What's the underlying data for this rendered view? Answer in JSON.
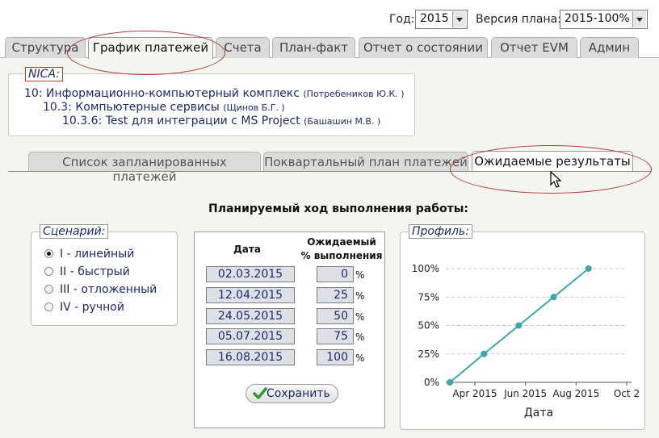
{
  "topbar": {
    "year_label": "Год:",
    "year_value": "2015",
    "version_label": "Версия плана:",
    "version_value": "2015-100%"
  },
  "main_tabs": [
    "Структура",
    "График платежей",
    "Счета",
    "План-факт",
    "Отчет о состоянии",
    "Отчет EVM",
    "Админ"
  ],
  "nica": {
    "label": "NICA:",
    "items": [
      {
        "text": "10: Информационно-компьютерный комплекс",
        "who": "(Потребеников Ю.К. )"
      },
      {
        "text": "10.3: Компьютерные сервисы",
        "who": "(Щинов Б.Г. )"
      },
      {
        "text": "10.3.6: Test для интеграции с MS Project",
        "who": "(Башашин М.В. )"
      }
    ]
  },
  "sub_tabs": [
    "Список запланированных платежей",
    "Поквартальный план платежей",
    "Ожидаемые результаты"
  ],
  "heading": "Планируемый ход выполнения работы:",
  "scenario": {
    "legend": "Сценарий:",
    "options": [
      "I - линейный",
      "II - быстрый",
      "III - отложенный",
      "IV - ручной"
    ],
    "selected": 0
  },
  "table": {
    "col_date": "Дата",
    "col_pct_line1": "Ожидаемый",
    "col_pct_line2": "% выполнения",
    "pct_sign": "%",
    "rows": [
      {
        "date": "02.03.2015",
        "pct": "0"
      },
      {
        "date": "12.04.2015",
        "pct": "25"
      },
      {
        "date": "24.05.2015",
        "pct": "50"
      },
      {
        "date": "05.07.2015",
        "pct": "75"
      },
      {
        "date": "16.08.2015",
        "pct": "100"
      }
    ],
    "save_label": "Сохранить"
  },
  "profile_legend": "Профиль:",
  "chart_data": {
    "type": "line",
    "title": "",
    "xlabel": "Дата",
    "ylabel": "",
    "x_ticks": [
      "Apr 2015",
      "Jun 2015",
      "Aug 2015",
      "Oct 2"
    ],
    "y_ticks": [
      "0%",
      "25%",
      "50%",
      "75%",
      "100%"
    ],
    "ylim": [
      0,
      100
    ],
    "series": [
      {
        "x": [
          "2015-03-02",
          "2015-04-12",
          "2015-05-24",
          "2015-07-05",
          "2015-08-16"
        ],
        "values": [
          0,
          25,
          50,
          75,
          100
        ]
      }
    ],
    "grid": true,
    "line_color": "#3da7ad"
  }
}
